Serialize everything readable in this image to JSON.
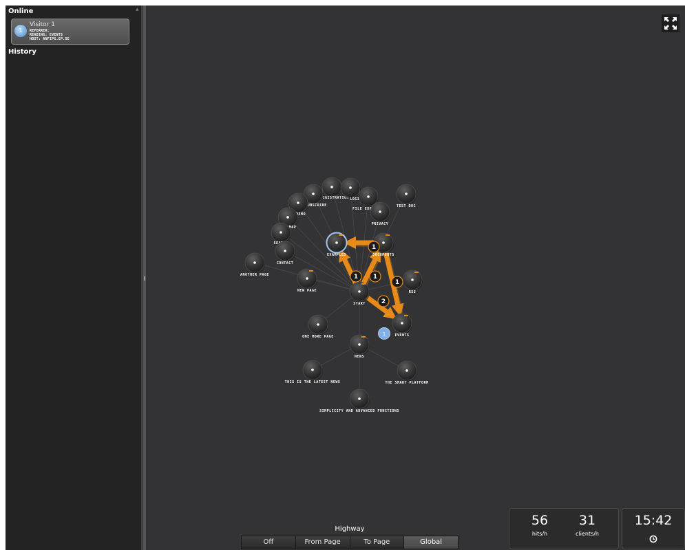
{
  "sidebar": {
    "online_heading": "Online",
    "history_heading": "History",
    "visitor": {
      "avatar": "1",
      "name": "Visitor 1",
      "referrer": "REFERRER:",
      "reading": "READING: EVENTS",
      "host": "HOST: ANFIPG.EP.SE"
    }
  },
  "graph": {
    "nodes": [
      {
        "id": "registration",
        "label": "REGISTRATION",
        "badge": false,
        "selected": false
      },
      {
        "id": "login",
        "label": "LOGIN",
        "badge": false,
        "selected": false
      },
      {
        "id": "subscribe",
        "label": "SUBSCRIBE",
        "badge": false,
        "selected": false
      },
      {
        "id": "file-explorer",
        "label": "FILE EXPLORER",
        "badge": false,
        "selected": false
      },
      {
        "id": "test-doc",
        "label": "TEST DOC",
        "badge": false,
        "selected": false
      },
      {
        "id": "privacy",
        "label": "PRIVACY",
        "badge": false,
        "selected": false
      },
      {
        "id": "demo",
        "label": "DEMO",
        "badge": false,
        "selected": false
      },
      {
        "id": "sitemap",
        "label": "SITEMAP",
        "badge": false,
        "selected": false
      },
      {
        "id": "search",
        "label": "SEARCH",
        "badge": false,
        "selected": false
      },
      {
        "id": "contact",
        "label": "CONTACT",
        "badge": false,
        "selected": false
      },
      {
        "id": "another-page",
        "label": "ANOTHER PAGE",
        "badge": false,
        "selected": false
      },
      {
        "id": "examples",
        "label": "EXAMPLES",
        "badge": true,
        "selected": true
      },
      {
        "id": "documents",
        "label": "DOCUMENTS",
        "badge": true,
        "selected": false
      },
      {
        "id": "new-page",
        "label": "NEW PAGE",
        "badge": true,
        "selected": false
      },
      {
        "id": "start",
        "label": "START",
        "badge": true,
        "selected": false
      },
      {
        "id": "rss",
        "label": "RSS",
        "badge": true,
        "selected": false
      },
      {
        "id": "events",
        "label": "EVENTS",
        "badge": true,
        "selected": false
      },
      {
        "id": "one-more-page",
        "label": "ONE MORE PAGE",
        "badge": false,
        "selected": false
      },
      {
        "id": "news",
        "label": "NEWS",
        "badge": true,
        "selected": false
      },
      {
        "id": "latest-news",
        "label": "THIS IS THE LATEST NEWS",
        "badge": false,
        "selected": false
      },
      {
        "id": "smart-platform",
        "label": "THE SMART PLATFORM",
        "badge": false,
        "selected": false
      },
      {
        "id": "simplicity",
        "label": "SIMPLICITY AND ADVANCED FUNCTIONS",
        "badge": false,
        "selected": false
      }
    ],
    "links": [
      [
        "start",
        "examples"
      ],
      [
        "start",
        "documents"
      ],
      [
        "start",
        "new-page"
      ],
      [
        "start",
        "rss"
      ],
      [
        "start",
        "events"
      ],
      [
        "start",
        "one-more-page"
      ],
      [
        "start",
        "news"
      ],
      [
        "start",
        "contact"
      ],
      [
        "start",
        "search"
      ],
      [
        "start",
        "sitemap"
      ],
      [
        "start",
        "demo"
      ],
      [
        "start",
        "subscribe"
      ],
      [
        "start",
        "registration"
      ],
      [
        "start",
        "login"
      ],
      [
        "start",
        "file-explorer"
      ],
      [
        "start",
        "privacy"
      ],
      [
        "start",
        "test-doc"
      ],
      [
        "start",
        "another-page"
      ],
      [
        "news",
        "latest-news"
      ],
      [
        "news",
        "smart-platform"
      ],
      [
        "news",
        "simplicity"
      ]
    ],
    "flows": [
      {
        "from": "start",
        "to": "examples",
        "count": "1"
      },
      {
        "from": "start",
        "to": "documents",
        "count": "1"
      },
      {
        "from": "documents",
        "to": "examples",
        "count": "1"
      },
      {
        "from": "documents",
        "to": "events",
        "count": "1"
      },
      {
        "from": "start",
        "to": "events",
        "count": "2"
      }
    ],
    "visitor_marker": {
      "node": "events",
      "label": "1"
    },
    "colors": {
      "flow": "#e88a1a",
      "flow_shadow": "#9a6a2a",
      "selected_ring": "#9fc6f0",
      "visitor": "#7fb0e6"
    }
  },
  "highway": {
    "title": "Highway",
    "options": [
      "Off",
      "From Page",
      "To Page",
      "Global"
    ],
    "active": "Global"
  },
  "stats": {
    "hits_value": "56",
    "hits_label": "hits/h",
    "clients_value": "31",
    "clients_label": "clients/h",
    "time": "15:42"
  },
  "icons": {
    "fullscreen": "fullscreen-icon",
    "clock": "clock-icon"
  }
}
